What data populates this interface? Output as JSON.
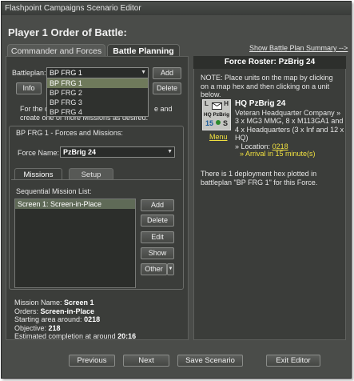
{
  "window": {
    "title": "Flashpoint Campaigns Scenario Editor"
  },
  "page_title": "Player 1 Order of Battle:",
  "tabs": [
    {
      "label": "Commander and Forces"
    },
    {
      "label": "Battle Planning"
    }
  ],
  "battleplan": {
    "label": "Battleplan:",
    "selected": "BP FRG 1",
    "options": [
      "BP FRG 1",
      "BP FRG 2",
      "BP FRG 3",
      "BP FRG 4"
    ],
    "add_label": "Add",
    "delete_label": "Delete",
    "info_label": "Info"
  },
  "instructions": {
    "line1_start": "For the c",
    "line1_end": "e and",
    "line2": "create one or more Missions as desired."
  },
  "forces_group": {
    "title": "BP FRG 1 - Forces and Missions:",
    "force_label": "Force Name:",
    "force_value": "PzBrig 24",
    "subtabs": [
      {
        "label": "Missions"
      },
      {
        "label": "Setup"
      }
    ],
    "list_title": "Sequential Mission List:",
    "missions": [
      "Screen 1: Screen-in-Place"
    ],
    "buttons": {
      "add": "Add",
      "delete": "Delete",
      "edit": "Edit",
      "show": "Show",
      "other": "Other"
    }
  },
  "mission_summary": {
    "name_label": "Mission Name:",
    "name_value": "Screen 1",
    "orders_label": "Orders:",
    "orders_value": "Screen-in-Place",
    "start_label": "Starting area around:",
    "start_value": "0218",
    "objective_label": "Objective:",
    "objective_value": "218",
    "completion_label": "Estimated completion at around",
    "completion_value": "20:16"
  },
  "right": {
    "summary_link": "Show Battle Plan Summary -->",
    "roster_title": "Force Roster: PzBrig 24",
    "note": "NOTE: Place units on the map by clicking on a map hex and then clicking on a unit below.",
    "unit": {
      "icon_letters": {
        "top_left": "L",
        "top_right": "H",
        "name": "HQ PzBrig",
        "number": "15",
        "status": "S"
      },
      "icon_label": "Menu",
      "name": "HQ PzBrig 24",
      "description": "Veteran Headquarter Company » 3 x MG3 MMG, 8 x M113GA1 and 4 x Headquarters (3 x Inf and 12 x HQ)",
      "location_prefix": "» Location:",
      "location_value": "0218",
      "arrival": "» Arrival in 15 minute(s)"
    },
    "deployment_note": "There is 1 deployment hex plotted in battleplan \"BP FRG 1\" for this Force."
  },
  "bottom_buttons": {
    "previous": "Previous",
    "next": "Next",
    "save": "Save Scenario",
    "exit": "Exit Editor"
  },
  "colors": {
    "background": "#4a4c49",
    "panel": "#3b3d3a",
    "selection": "#6f7a5b",
    "arrival_text": "#f0e040"
  }
}
